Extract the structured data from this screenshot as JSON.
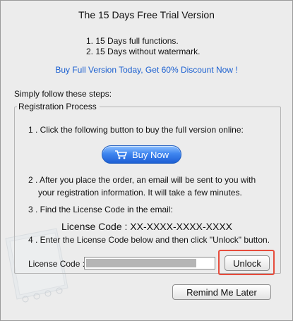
{
  "window": {
    "title": "The 15 Days Free Trial Version"
  },
  "features": [
    "1. 15 Days full functions.",
    "2. 15 Days without watermark."
  ],
  "promo_link": "Buy Full Version Today, Get 60% Discount Now !",
  "steps_intro": "Simply follow these steps:",
  "registration": {
    "legend": "Registration Process",
    "step1": "1 . Click the following button to buy the full version online:",
    "buy_button": "Buy Now",
    "step2_line1": "2 . After you place the order, an email will be sent to you with",
    "step2_line2": "your registration information. It will take a few minutes.",
    "step3": "3 . Find the License Code in the email:",
    "license_code_display": "License Code : XX-XXXX-XXXX-XXXX",
    "step4": "4 . Enter the License Code below and then click \"Unlock\" button.",
    "license_label": "License Code :",
    "license_value": "",
    "unlock_button": "Unlock"
  },
  "remind_button": "Remind Me Later",
  "colors": {
    "promo": "#1a5fd0",
    "highlight": "#e74c3c",
    "buy_button": "#2f78e8"
  },
  "icons": {
    "buy_button_icon": "shopping-cart-icon",
    "background_art": "notebook-illustration"
  }
}
